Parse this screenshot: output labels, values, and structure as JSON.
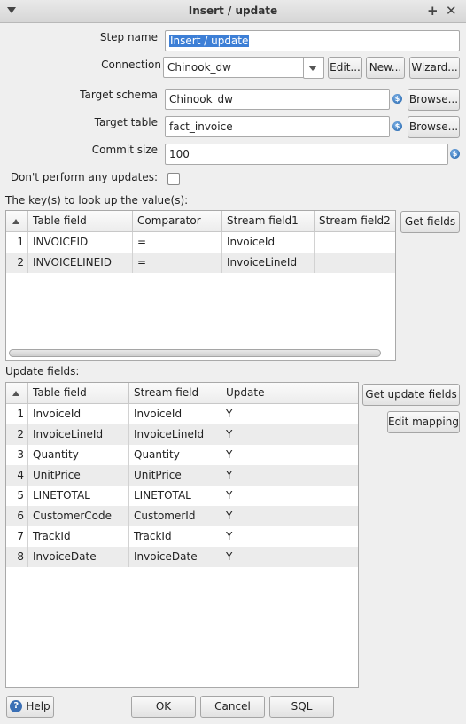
{
  "window": {
    "title": "Insert / update"
  },
  "form": {
    "step_name_label": "Step name",
    "step_name_value": "Insert / update",
    "connection_label": "Connection",
    "connection_value": "Chinook_dw",
    "edit_label": "Edit...",
    "new_label": "New...",
    "wizard_label": "Wizard...",
    "target_schema_label": "Target schema",
    "target_schema_value": "Chinook_dw",
    "browse_label": "Browse...",
    "target_table_label": "Target table",
    "target_table_value": "fact_invoice",
    "commit_size_label": "Commit size",
    "commit_size_value": "100",
    "dont_update_label": "Don't perform any updates:",
    "dont_update_checked": false
  },
  "keys": {
    "section_label": "The key(s) to look up the value(s):",
    "get_fields_label": "Get fields",
    "columns": [
      "Table field",
      "Comparator",
      "Stream field1",
      "Stream field2"
    ],
    "rows": [
      {
        "num": "1",
        "table_field": "INVOICEID",
        "comparator": "=",
        "stream1": "InvoiceId",
        "stream2": ""
      },
      {
        "num": "2",
        "table_field": "INVOICELINEID",
        "comparator": "=",
        "stream1": "InvoiceLineId",
        "stream2": ""
      }
    ]
  },
  "update": {
    "section_label": "Update fields:",
    "get_update_fields_label": "Get update fields",
    "edit_mapping_label": "Edit mapping",
    "columns": [
      "Table field",
      "Stream field",
      "Update"
    ],
    "rows": [
      {
        "num": "1",
        "table_field": "InvoiceId",
        "stream_field": "InvoiceId",
        "update": "Y"
      },
      {
        "num": "2",
        "table_field": "InvoiceLineId",
        "stream_field": "InvoiceLineId",
        "update": "Y"
      },
      {
        "num": "3",
        "table_field": "Quantity",
        "stream_field": "Quantity",
        "update": "Y"
      },
      {
        "num": "4",
        "table_field": "UnitPrice",
        "stream_field": "UnitPrice",
        "update": "Y"
      },
      {
        "num": "5",
        "table_field": "LINETOTAL",
        "stream_field": "LINETOTAL",
        "update": "Y"
      },
      {
        "num": "6",
        "table_field": "CustomerCode",
        "stream_field": "CustomerId",
        "update": "Y"
      },
      {
        "num": "7",
        "table_field": "TrackId",
        "stream_field": "TrackId",
        "update": "Y"
      },
      {
        "num": "8",
        "table_field": "InvoiceDate",
        "stream_field": "InvoiceDate",
        "update": "Y"
      }
    ]
  },
  "footer": {
    "help_label": "Help",
    "ok_label": "OK",
    "cancel_label": "Cancel",
    "sql_label": "SQL"
  },
  "icons": {
    "variable": "variable-dollar-icon",
    "help": "help-icon",
    "menu": "window-menu-icon",
    "maximize": "plus-icon",
    "close": "close-icon"
  }
}
